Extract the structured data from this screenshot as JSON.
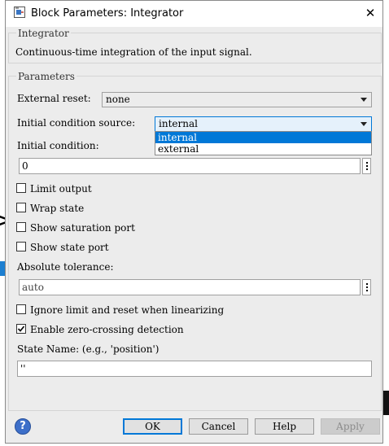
{
  "window": {
    "title": "Block Parameters: Integrator",
    "close_glyph": "✕"
  },
  "description_group": {
    "legend": "Integrator",
    "text": "Continuous-time integration of the input signal."
  },
  "parameters_group": {
    "legend": "Parameters",
    "external_reset": {
      "label": "External reset:",
      "value": "none"
    },
    "initial_condition_source": {
      "label": "Initial condition source:",
      "value": "internal",
      "options": [
        "internal",
        "external"
      ],
      "highlighted_option": "internal"
    },
    "initial_condition": {
      "label": "Initial condition:",
      "value": "0"
    },
    "checkboxes": [
      {
        "label": "Limit output",
        "checked": false
      },
      {
        "label": "Wrap state",
        "checked": false
      },
      {
        "label": "Show saturation port",
        "checked": false
      },
      {
        "label": "Show state port",
        "checked": false
      }
    ],
    "absolute_tolerance": {
      "label": "Absolute tolerance:",
      "value": "auto"
    },
    "ignore_limit": {
      "label": "Ignore limit and reset when linearizing",
      "checked": false
    },
    "zero_crossing": {
      "label": "Enable zero-crossing detection",
      "checked": true
    },
    "state_name": {
      "label": "State Name: (e.g., 'position')",
      "value": "''"
    }
  },
  "buttons": {
    "help_icon": "?",
    "ok": "OK",
    "cancel": "Cancel",
    "help": "Help",
    "apply": "Apply"
  },
  "colors": {
    "highlight": "#0078d7",
    "focus_border": "#0078d7",
    "combo_focus_bg": "#e5f1fb",
    "disabled_text": "#8c8c8c"
  }
}
